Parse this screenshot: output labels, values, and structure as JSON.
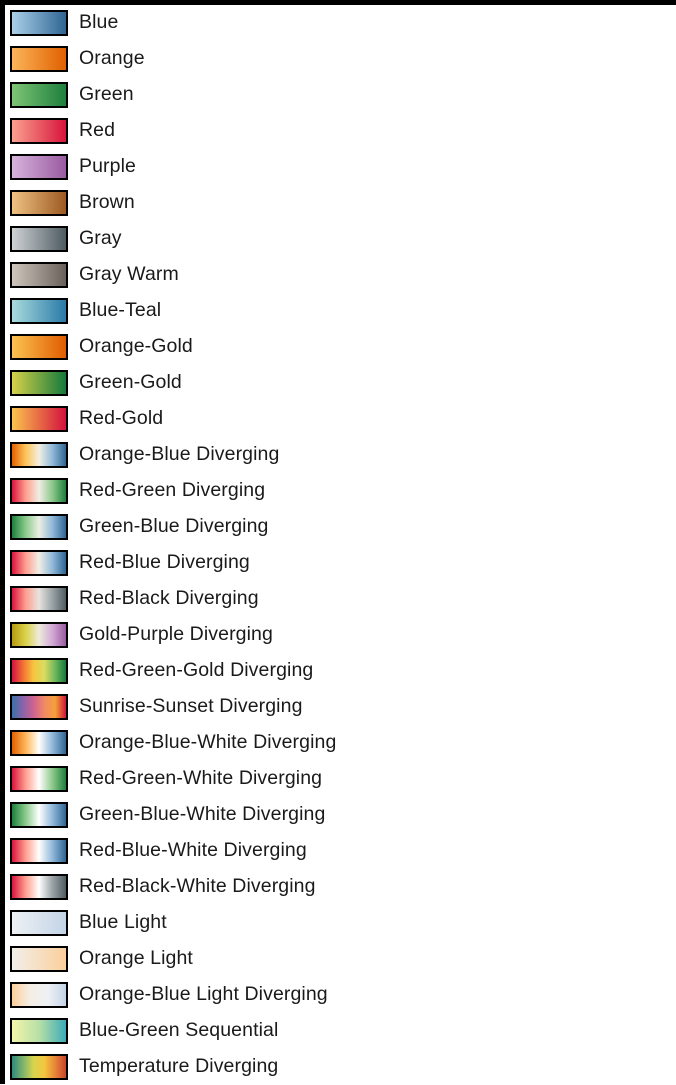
{
  "legend": {
    "orientation": "vertical",
    "swatch_border_color": "#000000",
    "background_color": "#ffffff",
    "frame_band_color": "#000000",
    "label_color": "#1a1a1a",
    "items": [
      {
        "name": "Blue",
        "type": "sequential",
        "stops": [
          "#aad0ea",
          "#2f6593"
        ]
      },
      {
        "name": "Orange",
        "type": "sequential",
        "stops": [
          "#fcb55a",
          "#e06000"
        ]
      },
      {
        "name": "Green",
        "type": "sequential",
        "stops": [
          "#7ec576",
          "#1d7f3c"
        ]
      },
      {
        "name": "Red",
        "type": "sequential",
        "stops": [
          "#fba08f",
          "#d8143c"
        ]
      },
      {
        "name": "Purple",
        "type": "sequential",
        "stops": [
          "#d7b3dc",
          "#9a5ba0"
        ]
      },
      {
        "name": "Brown",
        "type": "sequential",
        "stops": [
          "#f0c183",
          "#9c5a22"
        ]
      },
      {
        "name": "Gray",
        "type": "sequential",
        "stops": [
          "#cfd3d6",
          "#4e5c63"
        ]
      },
      {
        "name": "Gray Warm",
        "type": "sequential",
        "stops": [
          "#cfc6bd",
          "#6a605a"
        ]
      },
      {
        "name": "Blue-Teal",
        "type": "sequential",
        "stops": [
          "#a8dbdd",
          "#2a7aa8"
        ]
      },
      {
        "name": "Orange-Gold",
        "type": "sequential",
        "stops": [
          "#fcc352",
          "#e05c00"
        ]
      },
      {
        "name": "Green-Gold",
        "type": "sequential",
        "stops": [
          "#d6d24a",
          "#137a3c"
        ]
      },
      {
        "name": "Red-Gold",
        "type": "sequential",
        "stops": [
          "#fbc44e",
          "#d4123f"
        ]
      },
      {
        "name": "Orange-Blue Diverging",
        "type": "diverging",
        "stops": [
          "#e06000",
          "#fcc35a",
          "#f2efe4",
          "#8fb9da",
          "#2f6593"
        ]
      },
      {
        "name": "Red-Green Diverging",
        "type": "diverging",
        "stops": [
          "#d8143c",
          "#fb9f8e",
          "#f0eee4",
          "#8bc98a",
          "#1d7f3c"
        ]
      },
      {
        "name": "Green-Blue Diverging",
        "type": "diverging",
        "stops": [
          "#1d7f3c",
          "#8bc98a",
          "#eceee4",
          "#8fb9da",
          "#2f6593"
        ]
      },
      {
        "name": "Red-Blue Diverging",
        "type": "diverging",
        "stops": [
          "#d8143c",
          "#fb9f8e",
          "#f0eee6",
          "#8fb9da",
          "#2f6593"
        ]
      },
      {
        "name": "Red-Black Diverging",
        "type": "diverging",
        "stops": [
          "#d8143c",
          "#fb9f8e",
          "#e6e4e0",
          "#9aa2a6",
          "#4e5c63"
        ]
      },
      {
        "name": "Gold-Purple Diverging",
        "type": "diverging",
        "stops": [
          "#b59a10",
          "#d8d24a",
          "#eeeadd",
          "#d2a8d6",
          "#9a5ba0"
        ]
      },
      {
        "name": "Red-Green-Gold Diverging",
        "type": "diverging",
        "stops": [
          "#d4123f",
          "#f07030",
          "#f5c63f",
          "#d9dd62",
          "#6cb75e",
          "#137a3c"
        ]
      },
      {
        "name": "Sunrise-Sunset Diverging",
        "type": "diverging",
        "stops": [
          "#3d6fa8",
          "#8a63a8",
          "#d0628f",
          "#f08a62",
          "#f5a03a",
          "#d4123f"
        ]
      },
      {
        "name": "Orange-Blue-White Diverging",
        "type": "diverging",
        "stops": [
          "#e06000",
          "#fcb55a",
          "#ffffff",
          "#8fb9da",
          "#2f6593"
        ]
      },
      {
        "name": "Red-Green-White Diverging",
        "type": "diverging",
        "stops": [
          "#d8143c",
          "#fb9f8e",
          "#ffffff",
          "#8bc98a",
          "#1d7f3c"
        ]
      },
      {
        "name": "Green-Blue-White Diverging",
        "type": "diverging",
        "stops": [
          "#1d7f3c",
          "#8bc98a",
          "#ffffff",
          "#8fb9da",
          "#2f6593"
        ]
      },
      {
        "name": "Red-Blue-White Diverging",
        "type": "diverging",
        "stops": [
          "#d8143c",
          "#fb9f8e",
          "#ffffff",
          "#8fb9da",
          "#2f6593"
        ]
      },
      {
        "name": "Red-Black-White Diverging",
        "type": "diverging",
        "stops": [
          "#d8143c",
          "#fb9f8e",
          "#ffffff",
          "#9aa2a6",
          "#4e5c63"
        ]
      },
      {
        "name": "Blue Light",
        "type": "sequential",
        "stops": [
          "#eef1f4",
          "#c3d4e8"
        ]
      },
      {
        "name": "Orange Light",
        "type": "sequential",
        "stops": [
          "#f2efe9",
          "#fbcf9b"
        ]
      },
      {
        "name": "Orange-Blue Light Diverging",
        "type": "diverging",
        "stops": [
          "#fbcf9b",
          "#f4eee6",
          "#eef1f4",
          "#c3d4e8"
        ]
      },
      {
        "name": "Blue-Green Sequential",
        "type": "sequential",
        "stops": [
          "#f2f5a9",
          "#b8e0a8",
          "#3aacb8"
        ]
      },
      {
        "name": "Temperature Diverging",
        "type": "diverging",
        "stops": [
          "#2f8a7a",
          "#7fb26a",
          "#d8d44a",
          "#f5c63f",
          "#e8843a",
          "#c8442f"
        ]
      }
    ]
  }
}
